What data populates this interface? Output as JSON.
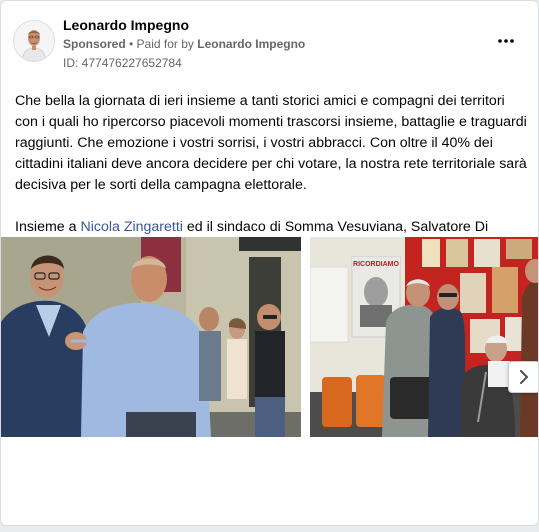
{
  "post": {
    "author": "Leonardo Impegno",
    "sponsored_label": "Sponsored",
    "paid_for_label": " • Paid for by ",
    "paid_for_name": "Leonardo Impegno",
    "id_line": "ID: 477476227652784",
    "text_paragraph_1": "Che bella la giornata di ieri insieme a tanti storici amici e compagni dei territori con i quali ho ripercorso piacevoli momenti trascorsi insieme, battaglie e traguardi raggiunti. Che emozione i vostri sorrisi, i vostri abbracci. Con oltre il 40% dei cittadini italiani deve ancora decidere per chi votare, la nostra rete territoriale sarà decisiva per le sorti della campagna elettorale.",
    "text_paragraph_2_prefix": "Insieme a ",
    "text_paragraph_2_mention": "Nicola Zingaretti",
    "text_paragraph_2_suffix": " ed il sindaco di Somma Vesuviana, Salvatore Di Sarno…"
  },
  "carousel": {
    "poster_text": "RICORDIAMO"
  },
  "colors": {
    "link": "#385898",
    "secondary_text": "#65676b",
    "card_border": "#dadde1"
  },
  "icons": {
    "more": "more-horizontal-icon",
    "next": "chevron-right-icon",
    "avatar": "avatar-portrait"
  }
}
